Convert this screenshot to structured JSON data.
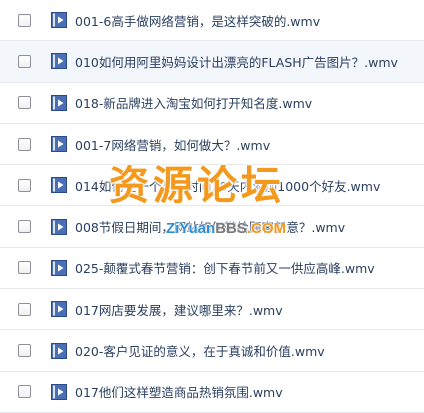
{
  "files": [
    {
      "name": "001-6高手做网络营销，是这样突破的.wmv"
    },
    {
      "name": "010如何用阿里妈妈设计出漂亮的FLASH广告图片？.wmv"
    },
    {
      "name": "018-新品牌进入淘宝如何打开知名度.wmv"
    },
    {
      "name": "001-7网络营销，如何做大？.wmv"
    },
    {
      "name": "014如何在一个月的时间10天内添加1000个好友.wmv"
    },
    {
      "name": "008节假日期间，网站如何带给顾客新意？.wmv"
    },
    {
      "name": "025-颠覆式春节营销：创下春节前又一供应高峰.wmv"
    },
    {
      "name": "017网店要发展，建议哪里来？.wmv"
    },
    {
      "name": "020-客户见证的意义，在于真诚和价值.wmv"
    },
    {
      "name": "017他们这样塑造商品热销氛围.wmv"
    }
  ],
  "icon": "video-file-icon",
  "watermark": {
    "title": "资源论坛",
    "url_part1": "ZiYuan",
    "url_part2": "BBS",
    "url_part3": ".COM"
  },
  "colors": {
    "text": "#2a3f60",
    "icon_blue": "#3b5da5",
    "watermark_orange": "#f39a1e",
    "watermark_blue": "#2e8ed8"
  }
}
